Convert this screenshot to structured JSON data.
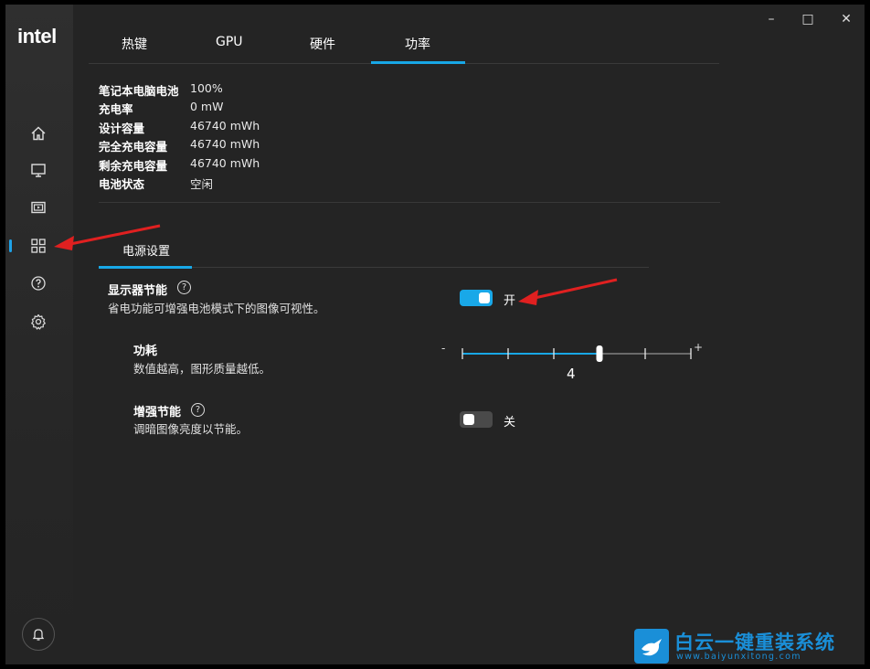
{
  "app": {
    "logo": "intel"
  },
  "window_controls": {
    "minimize": "–",
    "maximize": "□",
    "close": "✕"
  },
  "sidebar": {
    "items": [
      {
        "name": "home-icon"
      },
      {
        "name": "display-icon"
      },
      {
        "name": "video-icon"
      },
      {
        "name": "grid-icon",
        "active": true
      },
      {
        "name": "help-icon"
      },
      {
        "name": "gear-icon"
      }
    ],
    "bottom": {
      "name": "bell-icon"
    }
  },
  "tabs": [
    "热键",
    "GPU",
    "硬件",
    "功率"
  ],
  "active_tab": "功率",
  "battery": {
    "rows": [
      {
        "label": "笔记本电脑电池",
        "value": "100%"
      },
      {
        "label": "充电率",
        "value": "0 mW"
      },
      {
        "label": "设计容量",
        "value": "46740 mWh"
      },
      {
        "label": "完全充电容量",
        "value": "46740 mWh"
      },
      {
        "label": "剩余充电容量",
        "value": "46740 mWh"
      },
      {
        "label": "电池状态",
        "value": "空闲"
      }
    ]
  },
  "subtab": {
    "label": "电源设置"
  },
  "display_power": {
    "title": "显示器节能",
    "desc": "省电功能可增强电池模式下的图像可视性。",
    "help": "?",
    "toggle_on": true,
    "toggle_label": "开"
  },
  "power": {
    "title": "功耗",
    "desc": "数值越高，图形质量越低。",
    "minus": "-",
    "plus": "+",
    "value": "4",
    "level": 4,
    "steps": 6
  },
  "enhanced": {
    "title": "增强节能",
    "desc": "调暗图像亮度以节能。",
    "help": "?",
    "toggle_on": false,
    "toggle_label": "关"
  },
  "watermark": {
    "text": "白云一键重装系统",
    "url": "www.baiyunxitong.com"
  },
  "colors": {
    "accent": "#18a7e6",
    "annotation_arrow": "#e02020",
    "background": "#242424"
  }
}
